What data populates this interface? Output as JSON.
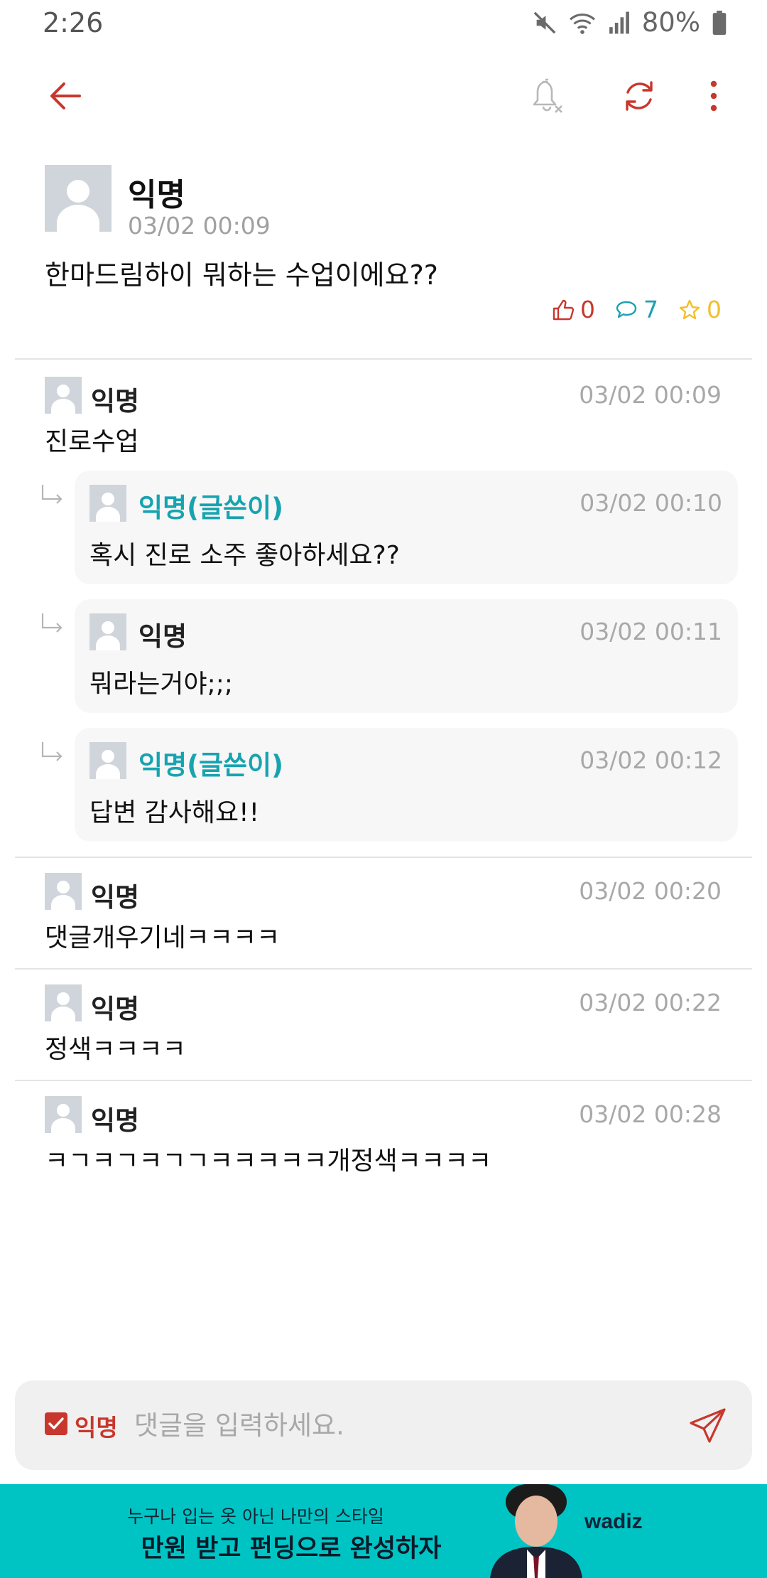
{
  "status_bar": {
    "time": "2:26",
    "battery": "80%"
  },
  "post": {
    "author": "익명",
    "date": "03/02 00:09",
    "body": "한마드림하이 뭐하는 수업이에요??",
    "likes": "0",
    "comments": "7",
    "scraps": "0"
  },
  "comments": [
    {
      "author": "익명",
      "date": "03/02 00:09",
      "body": "진로수업",
      "replies": [
        {
          "author": "익명(글쓴이)",
          "date": "03/02 00:10",
          "body": "혹시 진로 소주 좋아하세요??"
        },
        {
          "author": "익명",
          "date": "03/02 00:11",
          "body": "뭐라는거야;;;"
        },
        {
          "author": "익명(글쓴이)",
          "date": "03/02 00:12",
          "body": "답변 감사해요!!"
        }
      ]
    },
    {
      "author": "익명",
      "date": "03/02 00:20",
      "body": "댓글개우기네ㅋㅋㅋㅋ"
    },
    {
      "author": "익명",
      "date": "03/02 00:22",
      "body": "정색ㅋㅋㅋㅋ"
    },
    {
      "author": "익명",
      "date": "03/02 00:28",
      "body": "ㅋㄱㅋㄱㅋㄱㄱㅋㅋㅋㅋㅋ개정색ㅋㅋㅋㅋ"
    }
  ],
  "input_bar": {
    "anonymous_label": "익명",
    "anonymous_checked": true,
    "placeholder": "댓글을 입력하세요."
  },
  "ad": {
    "line1": "누구나 입는 옷 아닌 나만의 스타일",
    "line2": "만원 받고 펀딩으로 완성하자",
    "brand": "wadiz"
  },
  "colors": {
    "accent": "#c8372d",
    "op_highlight": "#17a3b0",
    "comment_count": "#1ea0b4",
    "scrap": "#f2c029",
    "ad_background": "#00c4c4"
  },
  "icons": {
    "back": "arrow-left-icon",
    "notifications": "bell-off-icon",
    "refresh": "refresh-icon",
    "more": "more-vertical-icon",
    "send": "paper-plane-icon"
  }
}
